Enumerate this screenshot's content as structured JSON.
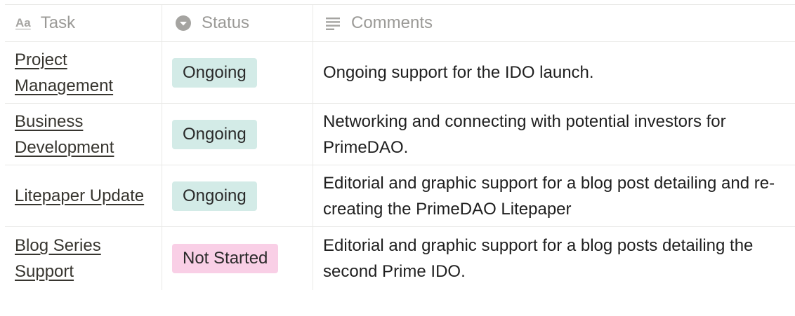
{
  "header": {
    "task_label": "Task",
    "status_label": "Status",
    "comments_label": "Comments",
    "task_icon_text": "Aa",
    "task_icon": "text-property-icon",
    "status_icon": "select-property-icon",
    "comments_icon": "text-lines-icon"
  },
  "colors": {
    "ongoing_badge_bg": "#d3ebe7",
    "not_started_badge_bg": "#f9cfe6",
    "border": "#e9e9e7",
    "header_text": "#9b9a97"
  },
  "rows": [
    {
      "task": "Project Management",
      "status": "Ongoing",
      "comment": "Ongoing support for the IDO launch."
    },
    {
      "task": "Business Development",
      "status": "Ongoing",
      "comment": "Networking and connecting with potential investors for PrimeDAO."
    },
    {
      "task": "Litepaper Update",
      "status": "Ongoing",
      "comment": "Editorial and graphic support for a blog post detailing and re-creating the PrimeDAO Litepaper"
    },
    {
      "task": "Blog Series Support",
      "status": "Not Started",
      "comment": "Editorial and graphic support for a blog posts detailing the second Prime IDO."
    }
  ]
}
